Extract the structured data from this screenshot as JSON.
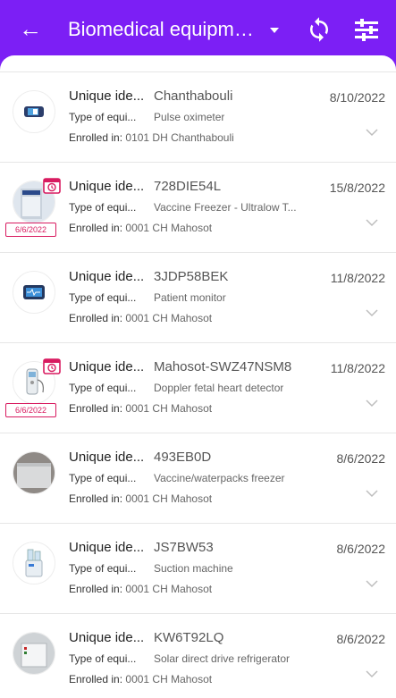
{
  "header": {
    "title": "Biomedical equipment",
    "back_icon": "arrow-left-icon",
    "sync_icon": "sync-icon",
    "filter_icon": "filter-list-icon"
  },
  "labels": {
    "unique": "Unique ide...",
    "type": "Type of equi...",
    "enrolled": "Enrolled in:"
  },
  "items": [
    {
      "id": "Chanthabouli",
      "date": "8/10/2022",
      "type": "Pulse oximeter",
      "enrolled": "0101 DH Chanthabouli",
      "badge": null,
      "icon": "pulse-oximeter-image"
    },
    {
      "id": "728DIE54L",
      "date": "15/8/2022",
      "type": "Vaccine Freezer - Ultralow T...",
      "enrolled": "0001 CH Mahosot",
      "badge": "6/6/2022",
      "icon": "vaccine-freezer-image"
    },
    {
      "id": "3JDP58BEK",
      "date": "11/8/2022",
      "type": "Patient monitor",
      "enrolled": "0001 CH Mahosot",
      "badge": null,
      "icon": "patient-monitor-image"
    },
    {
      "id": "Mahosot-SWZ47NSM8",
      "date": "11/8/2022",
      "type": "Doppler fetal heart detector",
      "enrolled": "0001 CH Mahosot",
      "badge": "6/6/2022",
      "icon": "doppler-image"
    },
    {
      "id": "493EB0D",
      "date": "8/6/2022",
      "type": "Vaccine/waterpacks freezer",
      "enrolled": "0001 CH Mahosot",
      "badge": null,
      "icon": "freezer-image"
    },
    {
      "id": "JS7BW53",
      "date": "8/6/2022",
      "type": "Suction machine",
      "enrolled": "0001 CH Mahosot",
      "badge": null,
      "icon": "suction-machine-image"
    },
    {
      "id": "KW6T92LQ",
      "date": "8/6/2022",
      "type": "Solar direct drive refrigerator",
      "enrolled": "0001 CH Mahosot",
      "badge": null,
      "icon": "solar-refrigerator-image"
    }
  ],
  "colors": {
    "primary": "#7c1ff5",
    "badge": "#d81b60"
  }
}
